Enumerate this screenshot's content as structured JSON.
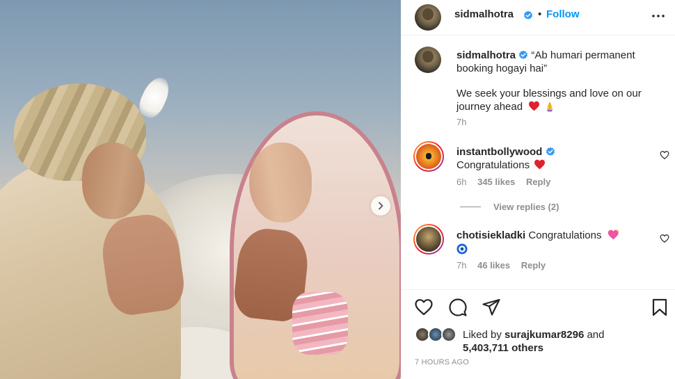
{
  "header": {
    "username": "sidmalhotra",
    "separator": "•",
    "follow_label": "Follow"
  },
  "caption": {
    "username": "sidmalhotra",
    "line1": "“Ab humari permanent booking hogayi hai”",
    "line2": "We seek your blessings and love on our journey ahead",
    "emojis": [
      "red-heart",
      "pray"
    ],
    "time": "7h"
  },
  "comments": [
    {
      "username": "instantbollywood",
      "verified": true,
      "text": "Congratulations",
      "emoji": "red-heart",
      "time": "6h",
      "likes": "345 likes",
      "reply_label": "Reply",
      "view_replies": "View replies (2)"
    },
    {
      "username": "chotisiekladki",
      "verified": false,
      "text": "Congratulations",
      "emojis": [
        "sparkling-heart",
        "nazar-amulet"
      ],
      "time": "7h",
      "likes": "46 likes",
      "reply_label": "Reply"
    }
  ],
  "likes": {
    "prefix": "Liked by",
    "user": "surajkumar8296",
    "and": "and",
    "others": "5,403,711 others"
  },
  "timeago": "7 HOURS AGO",
  "colors": {
    "accent": "#0095f6",
    "heart": "#ed4956",
    "verified": "#3897f0"
  },
  "icons": [
    "verified-icon",
    "more-options-icon",
    "heart-icon",
    "comment-icon",
    "share-icon",
    "bookmark-icon",
    "next-arrow-icon"
  ]
}
